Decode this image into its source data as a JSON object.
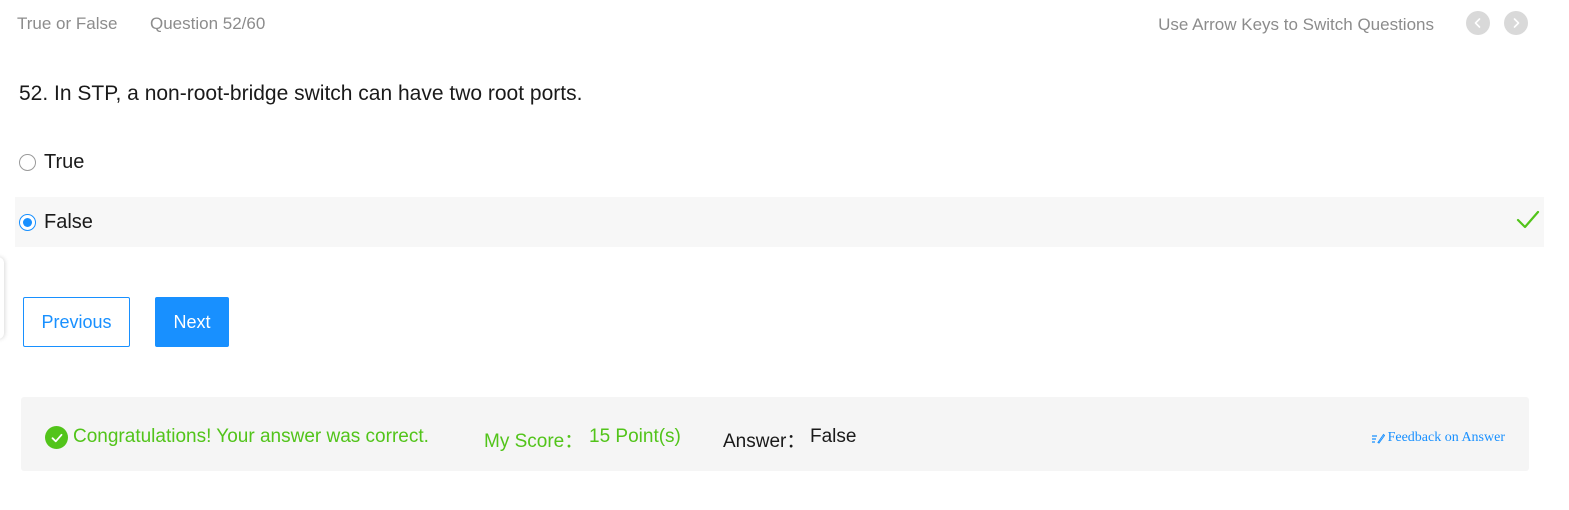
{
  "header": {
    "question_type": "True or False",
    "question_counter": "Question 52/60",
    "keyboard_hint": "Use Arrow Keys to Switch Questions",
    "prev_icon": "chevron-left-icon",
    "next_icon": "chevron-right-icon"
  },
  "question": {
    "text": "52. In STP, a non-root-bridge switch can have two root ports."
  },
  "options": [
    {
      "label": "True",
      "selected": false
    },
    {
      "label": "False",
      "selected": true,
      "marked_correct": true
    }
  ],
  "buttons": {
    "previous_label": "Previous",
    "next_label": "Next"
  },
  "result": {
    "message": "Congratulations! Your answer was correct.",
    "score_label": "My Score：",
    "score_value": "15 Point(s)",
    "answer_label": "Answer：",
    "answer_value": "False",
    "feedback_label": "Feedback on Answer"
  },
  "colors": {
    "accent": "#1890ff",
    "success": "#52c41a",
    "muted_text": "#8c8c8c",
    "panel_bg": "#f5f5f5"
  }
}
